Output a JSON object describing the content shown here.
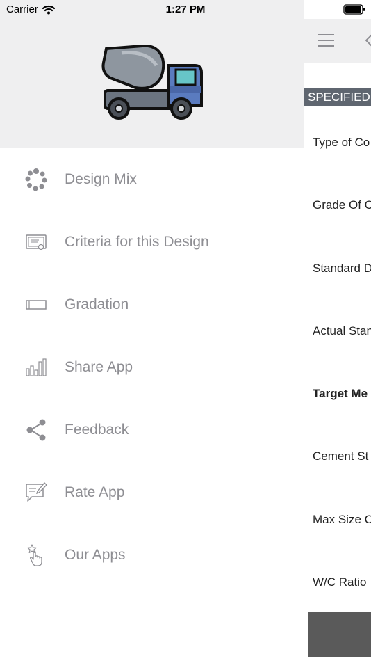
{
  "status_bar": {
    "carrier": "Carrier",
    "time": "1:27 PM"
  },
  "drawer": {
    "header_logo": "concrete-mixer-truck",
    "items": [
      {
        "label": "Design Mix",
        "icon": "loading-ring-icon"
      },
      {
        "label": "Criteria for this Design",
        "icon": "certificate-icon"
      },
      {
        "label": "Gradation",
        "icon": "rectangle-icon"
      },
      {
        "label": "Share App",
        "icon": "bar-chart-icon"
      },
      {
        "label": "Feedback",
        "icon": "share-icon"
      },
      {
        "label": "Rate App",
        "icon": "edit-message-icon"
      },
      {
        "label": "Our Apps",
        "icon": "tap-star-icon"
      }
    ]
  },
  "main": {
    "section_header": "SPECIFIED",
    "rows": [
      {
        "label": "Type of Co",
        "bold": false
      },
      {
        "label": "Grade Of C",
        "bold": false
      },
      {
        "label": "Standard D",
        "bold": false
      },
      {
        "label": "Actual Stan",
        "bold": false
      },
      {
        "label": "Target Me",
        "bold": true
      },
      {
        "label": "Cement St",
        "bold": false
      },
      {
        "label": "Max Size C",
        "bold": false
      },
      {
        "label": "W/C Ratio",
        "bold": false
      }
    ]
  },
  "colors": {
    "header_bg": "#efeff0",
    "menu_text": "#8e8e93",
    "section_header_bg": "#5f6670",
    "bottom_block": "#5a5a5a"
  }
}
